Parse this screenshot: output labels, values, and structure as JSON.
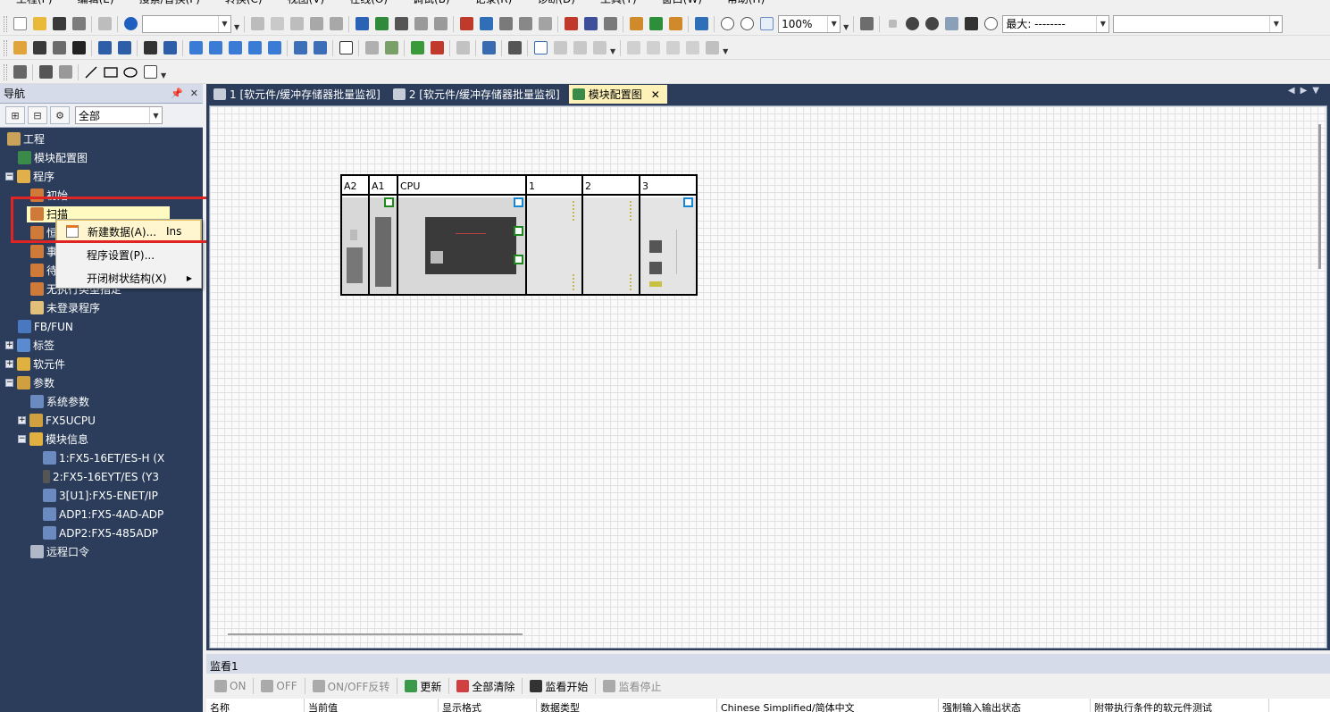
{
  "menu": [
    "工程(P)",
    "编辑(E)",
    "搜索/替换(F)",
    "转换(C)",
    "视图(V)",
    "在线(O)",
    "调试(B)",
    "记录(R)",
    "诊断(D)",
    "工具(T)",
    "窗口(W)",
    "帮助(H)"
  ],
  "toolbar": {
    "zoom_value": "100%",
    "max_label": "最大: --------"
  },
  "navigation": {
    "title": "导航",
    "filter_value": "全部",
    "tree": [
      {
        "label": "工程",
        "icon": "project-icon"
      },
      {
        "label": "模块配置图",
        "icon": "module-config-icon"
      },
      {
        "label": "程序",
        "icon": "program-folder-icon"
      },
      {
        "label": "初始",
        "icon": "program-icon"
      },
      {
        "label": "扫描",
        "icon": "program-icon"
      },
      {
        "label": "恒定周期",
        "icon": "program-icon"
      },
      {
        "label": "事件",
        "icon": "program-icon"
      },
      {
        "label": "待机",
        "icon": "program-icon"
      },
      {
        "label": "无执行类型指定",
        "icon": "program-icon"
      },
      {
        "label": "未登录程序",
        "icon": "program-icon"
      },
      {
        "label": "FB/FUN",
        "icon": "fb-icon"
      },
      {
        "label": "标签",
        "icon": "label-icon"
      },
      {
        "label": "软元件",
        "icon": "device-icon"
      },
      {
        "label": "参数",
        "icon": "parameter-icon"
      },
      {
        "label": "系统参数",
        "icon": "parameter-icon"
      },
      {
        "label": "FX5UCPU",
        "icon": "cpu-icon"
      },
      {
        "label": "模块信息",
        "icon": "module-info-icon"
      },
      {
        "label": "1:FX5-16ET/ES-H (X",
        "icon": "module-icon"
      },
      {
        "label": "2:FX5-16EYT/ES (Y3",
        "icon": "module-icon"
      },
      {
        "label": "3[U1]:FX5-ENET/IP",
        "icon": "module-icon"
      },
      {
        "label": "ADP1:FX5-4AD-ADP",
        "icon": "module-icon"
      },
      {
        "label": "ADP2:FX5-485ADP",
        "icon": "module-icon"
      },
      {
        "label": "远程口令",
        "icon": "remote-password-icon"
      }
    ]
  },
  "context_menu": {
    "items": [
      {
        "label": "新建数据(A)...",
        "shortcut": "Ins"
      },
      {
        "label": "程序设置(P)...",
        "shortcut": ""
      },
      {
        "label": "开闭树状结构(X)",
        "shortcut": ""
      }
    ]
  },
  "tabs": [
    {
      "label": "1 [软元件/缓冲存储器批量监视]"
    },
    {
      "label": "2 [软元件/缓冲存储器批量监视]"
    },
    {
      "label": "模块配置图"
    }
  ],
  "rack": {
    "slots": [
      {
        "label": "A2"
      },
      {
        "label": "A1"
      },
      {
        "label": "CPU"
      },
      {
        "label": "1"
      },
      {
        "label": "2"
      },
      {
        "label": "3"
      }
    ]
  },
  "watch": {
    "title": "监看1",
    "buttons": [
      {
        "label": "ON",
        "enabled": false
      },
      {
        "label": "OFF",
        "enabled": false
      },
      {
        "label": "ON/OFF反转",
        "enabled": false
      },
      {
        "label": "更新",
        "enabled": true
      },
      {
        "label": "全部清除",
        "enabled": true
      },
      {
        "label": "监看开始",
        "enabled": true
      },
      {
        "label": "监看停止",
        "enabled": false
      }
    ],
    "columns": [
      "名称",
      "当前值",
      "显示格式",
      "数据类型",
      "Chinese Simplified/简体中文",
      "强制输入输出状态",
      "附带执行条件的软元件测试"
    ]
  },
  "colors": {
    "nav_bg": "#2b3d5b",
    "selection": "#fffbc0",
    "highlight_box": "#e02424",
    "active_tab": "#fff2b8"
  }
}
